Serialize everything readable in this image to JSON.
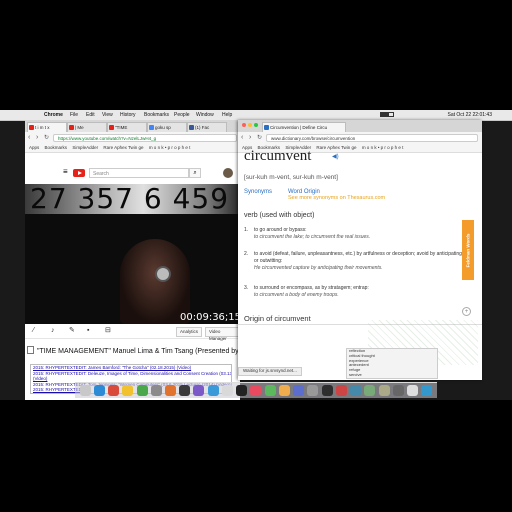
{
  "menubar": {
    "app": "Chrome",
    "items": [
      "File",
      "Edit",
      "View",
      "History",
      "Bookmarks",
      "People",
      "Window",
      "Help"
    ],
    "clock": "Sat Oct 22  22:01:43"
  },
  "left_window": {
    "tabs": [
      "t i m t x",
      "| Me",
      "\"TIME",
      "goku sp",
      "(1) Fac"
    ],
    "address": "https://www.youtube.com/watch?v=NzelLJwH4_g",
    "bookmarks": [
      "Apps",
      "Bookmarks",
      "SimpleAdder",
      "Rare Aphex Twin ge",
      "m o n k • p r o p h e t"
    ],
    "youtube": {
      "search_placeholder": "Search"
    },
    "video": {
      "counter": "27 357 6 459",
      "timecode": "00:09:36;15"
    },
    "toolbar": {
      "analytics": "Analytics",
      "video_manager": "Video Manager"
    },
    "title": "\"TIME MANAGEMENT\" Manuel Lima & Tim Tsang (Presented by",
    "description_links": [
      "2015: RHYPERTEXTEDIT: James Bamford: \"The Gotcha\" (02.18.2015) (Video)",
      "2015: RHYPERTEXTEDIT: Deleuze, Images of Time, Dimensionalities and Consent Creation (03.13.2015)",
      "(Video)",
      "2015: RHYPERTEXTEDIT: Tom Jennings: \"Women Computers\" (03.6.2015 Lecture) (2014) (Video)",
      "2015: RHYPERTEXTEDIT"
    ]
  },
  "right_window": {
    "tabs": [
      "Circumvention | Define Circu"
    ],
    "address": "www.dictionary.com/browse/circumvention",
    "bookmarks": [
      "Apps",
      "Bookmarks",
      "SimpleAdder",
      "Rare Aphex Twin ge",
      "m o n k • p r o p h e t"
    ],
    "word": "circumvent",
    "pronunciation": "[sur-kuh m-vent, sur-kuh m-vent]",
    "tab_synonyms": "Synonyms",
    "tab_word_origin": "Word Origin",
    "more_synonyms": "See more synonyms on Thesaurus.com",
    "part_of_speech": "verb (used with object)",
    "definitions": [
      {
        "num": "1.",
        "text": "to go around or bypass:",
        "example": "to circumvent the lake; to circumvent the real issues."
      },
      {
        "num": "2.",
        "text": "to avoid (defeat, failure, unpleasantness, etc.) by artfulness or deception; avoid by anticipating or outwitting:",
        "example": "He circumvented capture by anticipating their movements."
      },
      {
        "num": "3.",
        "text": "to surround or encompass, as by stratagem; entrap:",
        "example": "to circumvent a body of enemy troops."
      }
    ],
    "origin_heading": "Origin of circumvent",
    "status": "Waiting for js.srvsynd.net..."
  },
  "side_tab_label": "Feldman Words",
  "side_list": [
    "reflection",
    "critical thought",
    "experience",
    "antecedent",
    "refuge",
    "sercive"
  ],
  "dock_colors": [
    "#c8c8c8",
    "#2d8bd6",
    "#d94a3b",
    "#f2c12e",
    "#4aa84a",
    "#8b8b8b",
    "#e0732d",
    "#3b3b3b",
    "#7b5ac8",
    "#3a9ad9",
    "#d9d9d9",
    "#222222",
    "#e84a5f",
    "#5cb85c",
    "#f0ad4e",
    "#5b6dcd",
    "#999999",
    "#2e2e2e",
    "#c44",
    "#48a",
    "#7a7",
    "#aa8",
    "#666",
    "#ddd",
    "#39c"
  ]
}
